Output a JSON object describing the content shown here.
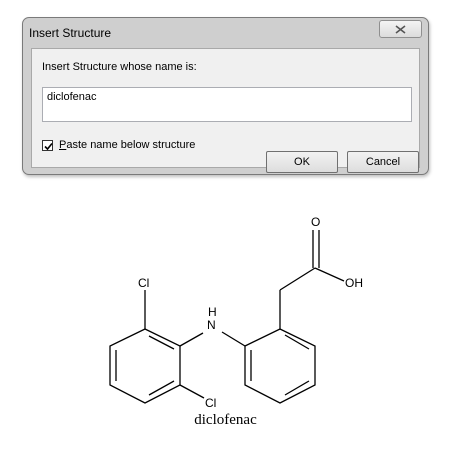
{
  "dialog": {
    "title": "Insert Structure",
    "prompt": "Insert Structure whose name is:",
    "name_value": "diclofenac",
    "checkbox": {
      "checked": true,
      "label_accel": "P",
      "label_rest": "aste name below structure"
    },
    "ok_label": "OK",
    "cancel_label": "Cancel"
  },
  "structure": {
    "atom_labels": {
      "oxygen_carbonyl": "O",
      "hydroxyl": "OH",
      "chlorine_top": "Cl",
      "chlorine_bottom": "Cl",
      "amine_h": "H",
      "amine_n": "N"
    },
    "caption": "diclofenac"
  }
}
